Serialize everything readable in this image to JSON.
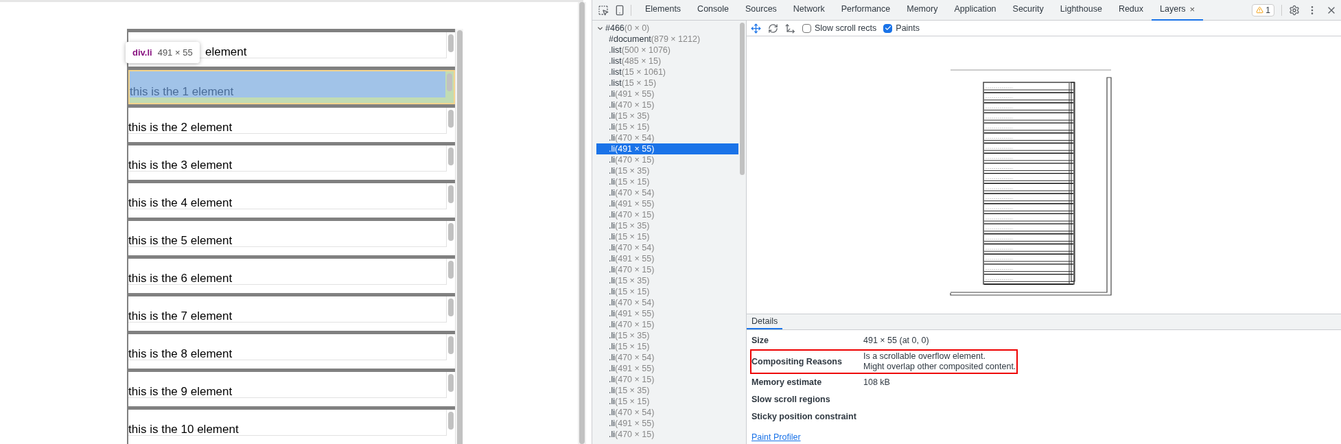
{
  "page": {
    "rows": [
      {
        "text": "element",
        "inspected": false
      },
      {
        "text": "this is the 1 element",
        "inspected": true
      },
      {
        "text": "this is the 2 element",
        "inspected": false
      },
      {
        "text": "this is the 3 element",
        "inspected": false
      },
      {
        "text": "this is the 4 element",
        "inspected": false
      },
      {
        "text": "this is the 5 element",
        "inspected": false
      },
      {
        "text": "this is the 6 element",
        "inspected": false
      },
      {
        "text": "this is the 7 element",
        "inspected": false
      },
      {
        "text": "this is the 8 element",
        "inspected": false
      },
      {
        "text": "this is the 9 element",
        "inspected": false
      },
      {
        "text": "this is the 10 element",
        "inspected": false
      }
    ],
    "tooltip": {
      "tag": "div.li",
      "size": "491 × 55"
    }
  },
  "devtools": {
    "tabs": [
      {
        "label": "Elements",
        "selected": false
      },
      {
        "label": "Console",
        "selected": false
      },
      {
        "label": "Sources",
        "selected": false
      },
      {
        "label": "Network",
        "selected": false
      },
      {
        "label": "Performance",
        "selected": false
      },
      {
        "label": "Memory",
        "selected": false
      },
      {
        "label": "Application",
        "selected": false
      },
      {
        "label": "Security",
        "selected": false
      },
      {
        "label": "Lighthouse",
        "selected": false
      },
      {
        "label": "Redux",
        "selected": false
      },
      {
        "label": "Layers",
        "selected": true,
        "close": "×"
      }
    ],
    "warning_count": "1",
    "toolbar": {
      "checkboxes": [
        {
          "label": "Slow scroll rects",
          "checked": false
        },
        {
          "label": "Paints",
          "checked": true
        }
      ]
    },
    "layer_tree": {
      "name": "#466",
      "size": "(0 × 0)",
      "expanded": true,
      "selected": false,
      "children": [
        {
          "name": "#document",
          "size": "(879 × 1212)",
          "selected": false
        },
        {
          "name": ".list",
          "size": "(500 × 1076)",
          "selected": false
        },
        {
          "name": ".list",
          "size": "(485 × 15)",
          "selected": false
        },
        {
          "name": ".list",
          "size": "(15 × 1061)",
          "selected": false
        },
        {
          "name": ".list",
          "size": "(15 × 15)",
          "selected": false
        },
        {
          "name": ".li",
          "size": "(491 × 55)",
          "selected": false
        },
        {
          "name": ".li",
          "size": "(470 × 15)",
          "selected": false
        },
        {
          "name": ".li",
          "size": "(15 × 35)",
          "selected": false
        },
        {
          "name": ".li",
          "size": "(15 × 15)",
          "selected": false
        },
        {
          "name": ".li",
          "size": "(470 × 54)",
          "selected": false
        },
        {
          "name": ".li",
          "size": "(491 × 55)",
          "selected": true
        },
        {
          "name": ".li",
          "size": "(470 × 15)",
          "selected": false
        },
        {
          "name": ".li",
          "size": "(15 × 35)",
          "selected": false
        },
        {
          "name": ".li",
          "size": "(15 × 15)",
          "selected": false
        },
        {
          "name": ".li",
          "size": "(470 × 54)",
          "selected": false
        },
        {
          "name": ".li",
          "size": "(491 × 55)",
          "selected": false
        },
        {
          "name": ".li",
          "size": "(470 × 15)",
          "selected": false
        },
        {
          "name": ".li",
          "size": "(15 × 35)",
          "selected": false
        },
        {
          "name": ".li",
          "size": "(15 × 15)",
          "selected": false
        },
        {
          "name": ".li",
          "size": "(470 × 54)",
          "selected": false
        },
        {
          "name": ".li",
          "size": "(491 × 55)",
          "selected": false
        },
        {
          "name": ".li",
          "size": "(470 × 15)",
          "selected": false
        },
        {
          "name": ".li",
          "size": "(15 × 35)",
          "selected": false
        },
        {
          "name": ".li",
          "size": "(15 × 15)",
          "selected": false
        },
        {
          "name": ".li",
          "size": "(470 × 54)",
          "selected": false
        },
        {
          "name": ".li",
          "size": "(491 × 55)",
          "selected": false
        },
        {
          "name": ".li",
          "size": "(470 × 15)",
          "selected": false
        },
        {
          "name": ".li",
          "size": "(15 × 35)",
          "selected": false
        },
        {
          "name": ".li",
          "size": "(15 × 15)",
          "selected": false
        },
        {
          "name": ".li",
          "size": "(470 × 54)",
          "selected": false
        },
        {
          "name": ".li",
          "size": "(491 × 55)",
          "selected": false
        },
        {
          "name": ".li",
          "size": "(470 × 15)",
          "selected": false
        },
        {
          "name": ".li",
          "size": "(15 × 35)",
          "selected": false
        },
        {
          "name": ".li",
          "size": "(15 × 15)",
          "selected": false
        },
        {
          "name": ".li",
          "size": "(470 × 54)",
          "selected": false
        },
        {
          "name": ".li",
          "size": "(491 × 55)",
          "selected": false
        },
        {
          "name": ".li",
          "size": "(470 × 15)",
          "selected": false
        }
      ]
    },
    "details": {
      "tab": "Details",
      "rows": [
        {
          "label": "Size",
          "value": "491 × 55 (at 0, 0)",
          "highlighted": false
        },
        {
          "label": "Compositing Reasons",
          "value": "Is a scrollable overflow element.\nMight overlap other composited content.",
          "highlighted": true
        },
        {
          "label": "Memory estimate",
          "value": "108 kB",
          "highlighted": false
        },
        {
          "label": "Slow scroll regions",
          "highlighted": false
        },
        {
          "label": "Sticky position constraint",
          "highlighted": false
        }
      ],
      "link": "Paint Profiler"
    }
  }
}
